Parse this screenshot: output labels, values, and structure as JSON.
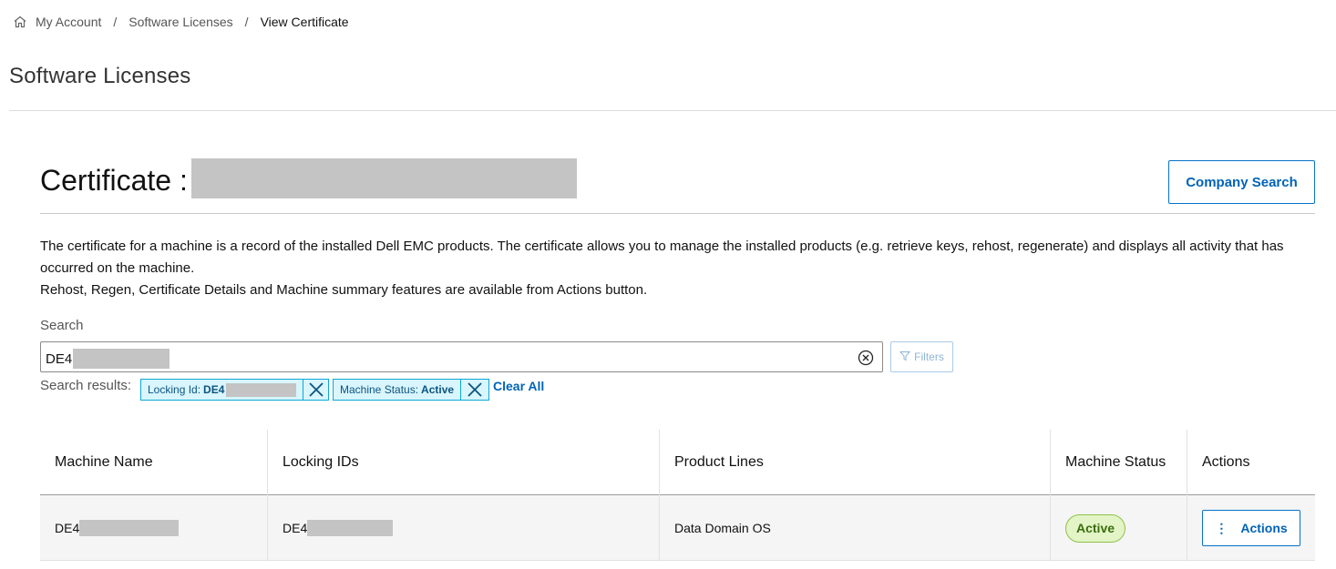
{
  "breadcrumb": {
    "items": [
      "My Account",
      "Software Licenses"
    ],
    "separator": "/",
    "current": "View Certificate"
  },
  "page": {
    "title": "Software Licenses"
  },
  "certificate": {
    "label": "Certificate :",
    "company_search_label": "Company Search"
  },
  "description": {
    "line1": "The certificate for a machine is a record of the installed Dell EMC products. The certificate allows you to manage the installed products (e.g. retrieve keys, rehost, regenerate) and displays all activity that has occurred on the machine.",
    "line2": "Rehost, Regen, Certificate Details and Machine summary features are available from Actions button."
  },
  "search": {
    "label": "Search",
    "value_prefix": "DE4",
    "filters_label": "Filters",
    "results_label": "Search results:",
    "chips": [
      {
        "key": "Locking Id:",
        "value": "DE4"
      },
      {
        "key": "Machine Status:",
        "value": "Active"
      }
    ],
    "clear_all_label": "Clear All"
  },
  "table": {
    "columns": [
      "Machine Name",
      "Locking IDs",
      "Product Lines",
      "Machine Status",
      "Actions"
    ],
    "rows": [
      {
        "machine_name": "DE4",
        "locking_id": "DE4",
        "product_lines": "Data Domain OS",
        "status": "Active",
        "actions_label": "Actions"
      }
    ]
  },
  "colors": {
    "accent": "#0672cb",
    "chip_bg": "#d9f5fd",
    "status_active_bg": "#e3f4c6",
    "redaction": "#c4c4c4"
  },
  "icons": {
    "home": "home-icon",
    "clear": "circle-x-icon",
    "filter": "funnel-icon",
    "chip_close": "close-icon",
    "kebab": "kebab-icon"
  }
}
